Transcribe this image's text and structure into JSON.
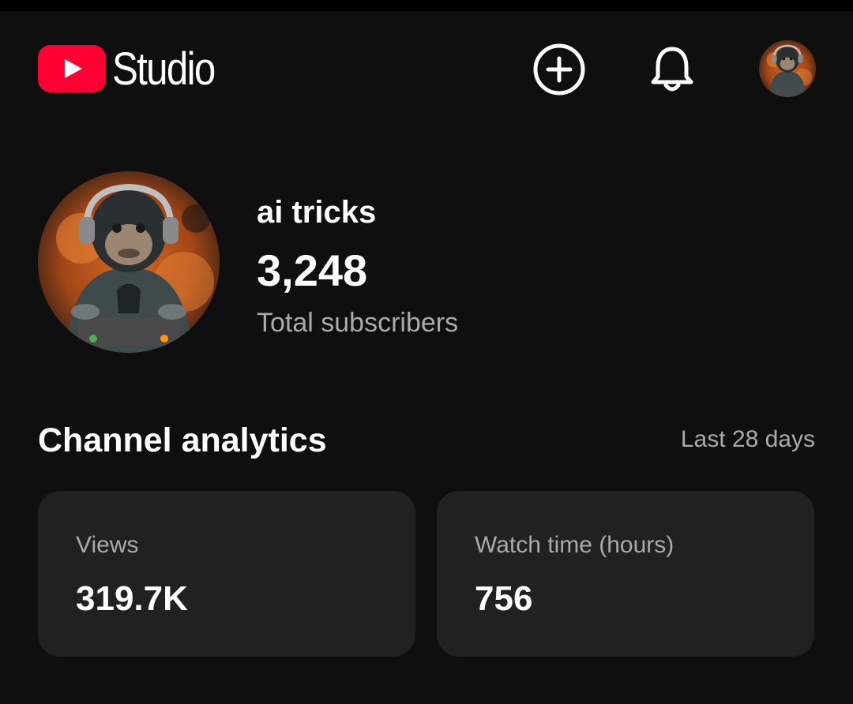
{
  "header": {
    "logo_text": "Studio",
    "icons": {
      "create": "create-plus-icon",
      "notifications": "bell-icon",
      "account": "avatar"
    }
  },
  "channel": {
    "name": "ai tricks",
    "subscribers": "3,248",
    "subscribers_label": "Total subscribers"
  },
  "analytics": {
    "title": "Channel analytics",
    "period": "Last 28 days",
    "cards": [
      {
        "label": "Views",
        "value": "319.7K"
      },
      {
        "label": "Watch time (hours)",
        "value": "756"
      }
    ]
  },
  "colors": {
    "background": "#0f0f0f",
    "card": "#212121",
    "brand_red": "#ff0033",
    "secondary_text": "#aaaaaa"
  }
}
